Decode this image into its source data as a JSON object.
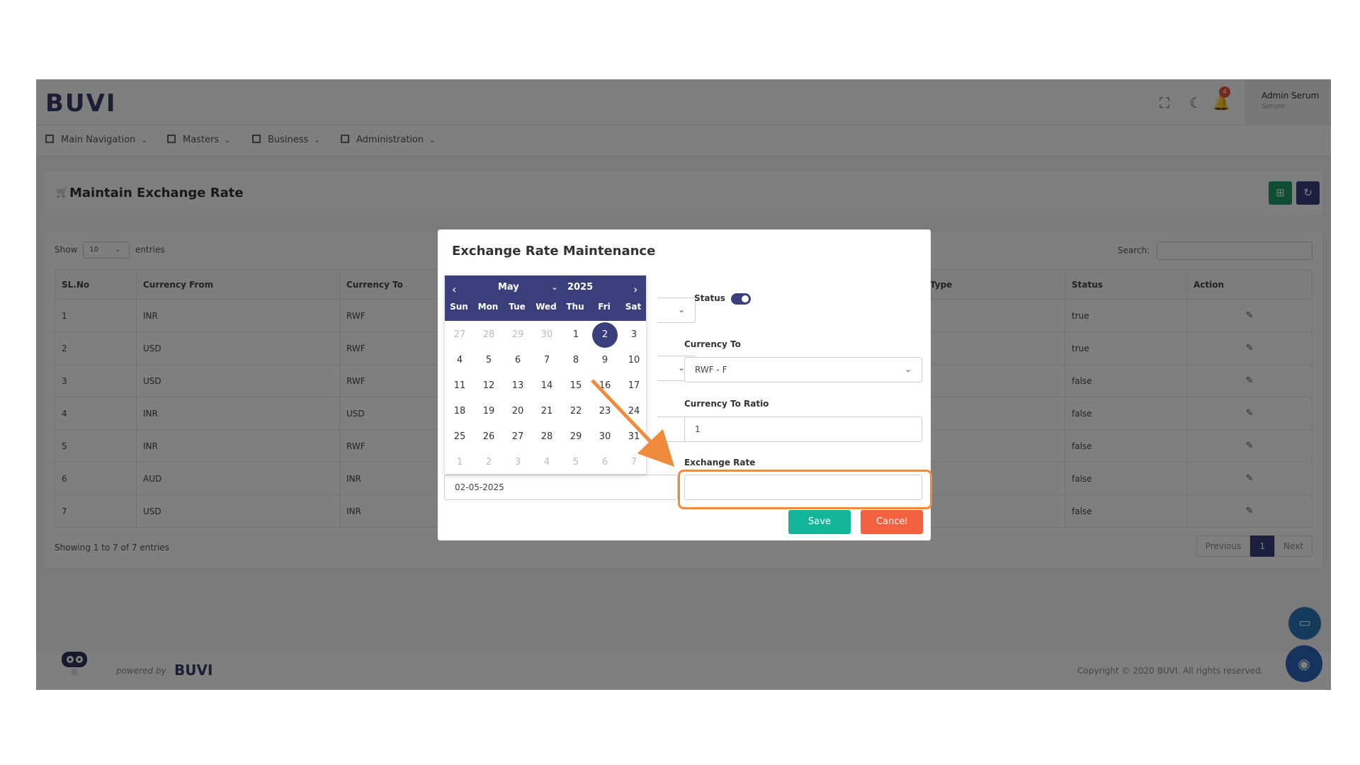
{
  "app": {
    "logo": "BUVI",
    "notification_count": "4",
    "user_name": "Admin Serum",
    "user_role": "Serum"
  },
  "menu": [
    {
      "label": "Main Navigation"
    },
    {
      "label": "Masters"
    },
    {
      "label": "Business"
    },
    {
      "label": "Administration"
    }
  ],
  "page": {
    "title": "Maintain Exchange Rate"
  },
  "table": {
    "show_label": "Show",
    "entries_value": "10",
    "entries_label": "entries",
    "search_label": "Search:",
    "columns": [
      "SL.No",
      "Currency From",
      "Currency To",
      "Type",
      "Status",
      "Action"
    ],
    "rows": [
      {
        "sl": "1",
        "from": "INR",
        "to": "RWF",
        "status": "true"
      },
      {
        "sl": "2",
        "from": "USD",
        "to": "RWF",
        "status": "true"
      },
      {
        "sl": "3",
        "from": "USD",
        "to": "RWF",
        "status": "false"
      },
      {
        "sl": "4",
        "from": "INR",
        "to": "USD",
        "status": "false"
      },
      {
        "sl": "5",
        "from": "INR",
        "to": "RWF",
        "status": "false"
      },
      {
        "sl": "6",
        "from": "AUD",
        "to": "INR",
        "status": "false"
      },
      {
        "sl": "7",
        "from": "USD",
        "to": "INR",
        "status": "false"
      }
    ],
    "showing_text": "Showing 1 to 7 of 7 entries",
    "pager": {
      "previous": "Previous",
      "current": "1",
      "next": "Next"
    }
  },
  "footer": {
    "powered_by": "powered by",
    "powered_logo": "BUVI",
    "copyright": "Copyright © 2020 BUVI. All rights reserved."
  },
  "modal": {
    "title": "Exchange Rate Maintenance",
    "status_label": "Status",
    "status_on": true,
    "currency_to_label": "Currency To",
    "currency_to_value": "RWF - F",
    "currency_to_ratio_label": "Currency To Ratio",
    "currency_to_ratio_value": "1",
    "exchange_rate_label": "Exchange Rate",
    "exchange_rate_value": "",
    "date_value": "02-05-2025",
    "save_label": "Save",
    "cancel_label": "Cancel"
  },
  "calendar": {
    "month": "May",
    "year": "2025",
    "weekdays": [
      "Sun",
      "Mon",
      "Tue",
      "Wed",
      "Thu",
      "Fri",
      "Sat"
    ],
    "weeks": [
      [
        "27",
        "28",
        "29",
        "30",
        "1",
        "2",
        "3"
      ],
      [
        "4",
        "5",
        "6",
        "7",
        "8",
        "9",
        "10"
      ],
      [
        "11",
        "12",
        "13",
        "14",
        "15",
        "16",
        "17"
      ],
      [
        "18",
        "19",
        "20",
        "21",
        "22",
        "23",
        "24"
      ],
      [
        "25",
        "26",
        "27",
        "28",
        "29",
        "30",
        "31"
      ],
      [
        "1",
        "2",
        "3",
        "4",
        "5",
        "6",
        "7"
      ]
    ],
    "selected_day": "2"
  },
  "colors": {
    "primary": "#3a3f7c",
    "save": "#15b59c",
    "cancel": "#f26140",
    "highlight": "#f08a3c",
    "green_btn": "#1e9b6f"
  }
}
